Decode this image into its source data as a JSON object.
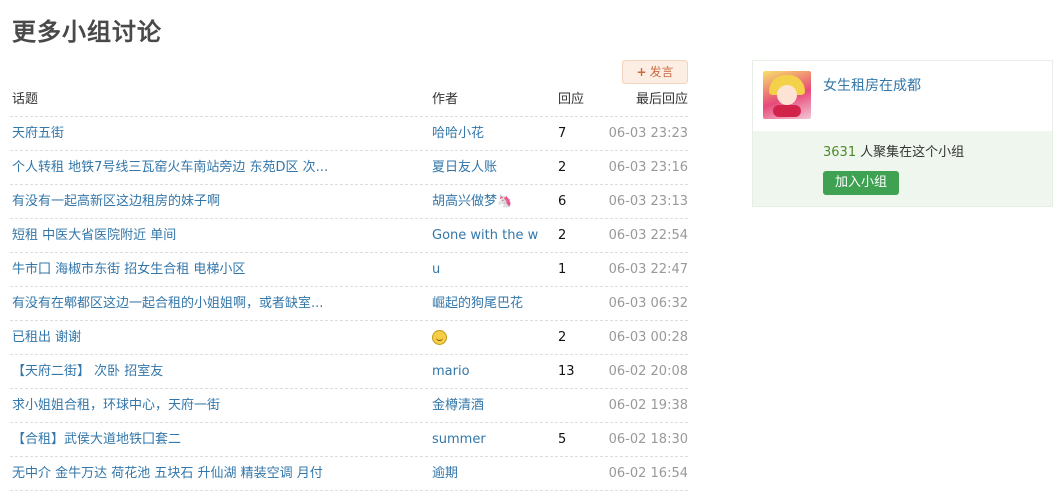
{
  "page": {
    "title": "更多小组讨论"
  },
  "actions": {
    "post_label": "发言",
    "post_icon": "plus-icon"
  },
  "table": {
    "columns": {
      "title": "话题",
      "author": "作者",
      "replies": "回应",
      "last_reply": "最后回应"
    },
    "rows": [
      {
        "title": "天府五街",
        "author": "哈哈小花",
        "replies": "7",
        "time": "06-03 23:23"
      },
      {
        "title": "个人转租 地铁7号线三瓦窑火车南站旁边 东苑D区 次...",
        "author": "夏日友人账",
        "replies": "2",
        "time": "06-03 23:16"
      },
      {
        "title": "有没有一起高新区这边租房的妹子啊",
        "author": "胡高兴做梦",
        "author_icon": "unicorn-icon",
        "replies": "6",
        "time": "06-03 23:13"
      },
      {
        "title": "短租 中医大省医院附近 单间",
        "author": "Gone with the w",
        "replies": "2",
        "time": "06-03 22:54"
      },
      {
        "title": "牛市囗 海椒市东街 招女生合租 电梯小区",
        "author": "u",
        "replies": "1",
        "time": "06-03 22:47"
      },
      {
        "title": "有没有在郫都区这边一起合租的小姐姐啊，或者缺室...",
        "author": "崛起的狗尾巴花",
        "replies": "",
        "time": "06-03 06:32"
      },
      {
        "title": "已租出 谢谢",
        "author": "",
        "author_icon": "smiley-icon",
        "replies": "2",
        "time": "06-03 00:28"
      },
      {
        "title": "【天府二街】 次卧 招室友",
        "author": "mario",
        "replies": "13",
        "time": "06-02 20:08"
      },
      {
        "title": "求小姐姐合租，环球中心，天府一街",
        "author": "金樽清酒",
        "replies": "",
        "time": "06-02 19:38"
      },
      {
        "title": "【合租】武侯大道地铁囗套二",
        "author": "summer",
        "replies": "5",
        "time": "06-02 18:30"
      },
      {
        "title": "无中介 金牛万达 荷花池 五块石 升仙湖 精装空调 月付",
        "author": "逾期",
        "replies": "",
        "time": "06-02 16:54"
      }
    ]
  },
  "group": {
    "name": "女生租房在成都",
    "member_count": "3631",
    "member_suffix": "人聚集在这个小组",
    "join_label": "加入小组",
    "avatar_icon": "group-avatar-icon"
  },
  "colors": {
    "link": "#3377aa",
    "join_button": "#3fa152",
    "card_bottom": "#eef6ee",
    "post_button_bg": "#fdeee3"
  }
}
